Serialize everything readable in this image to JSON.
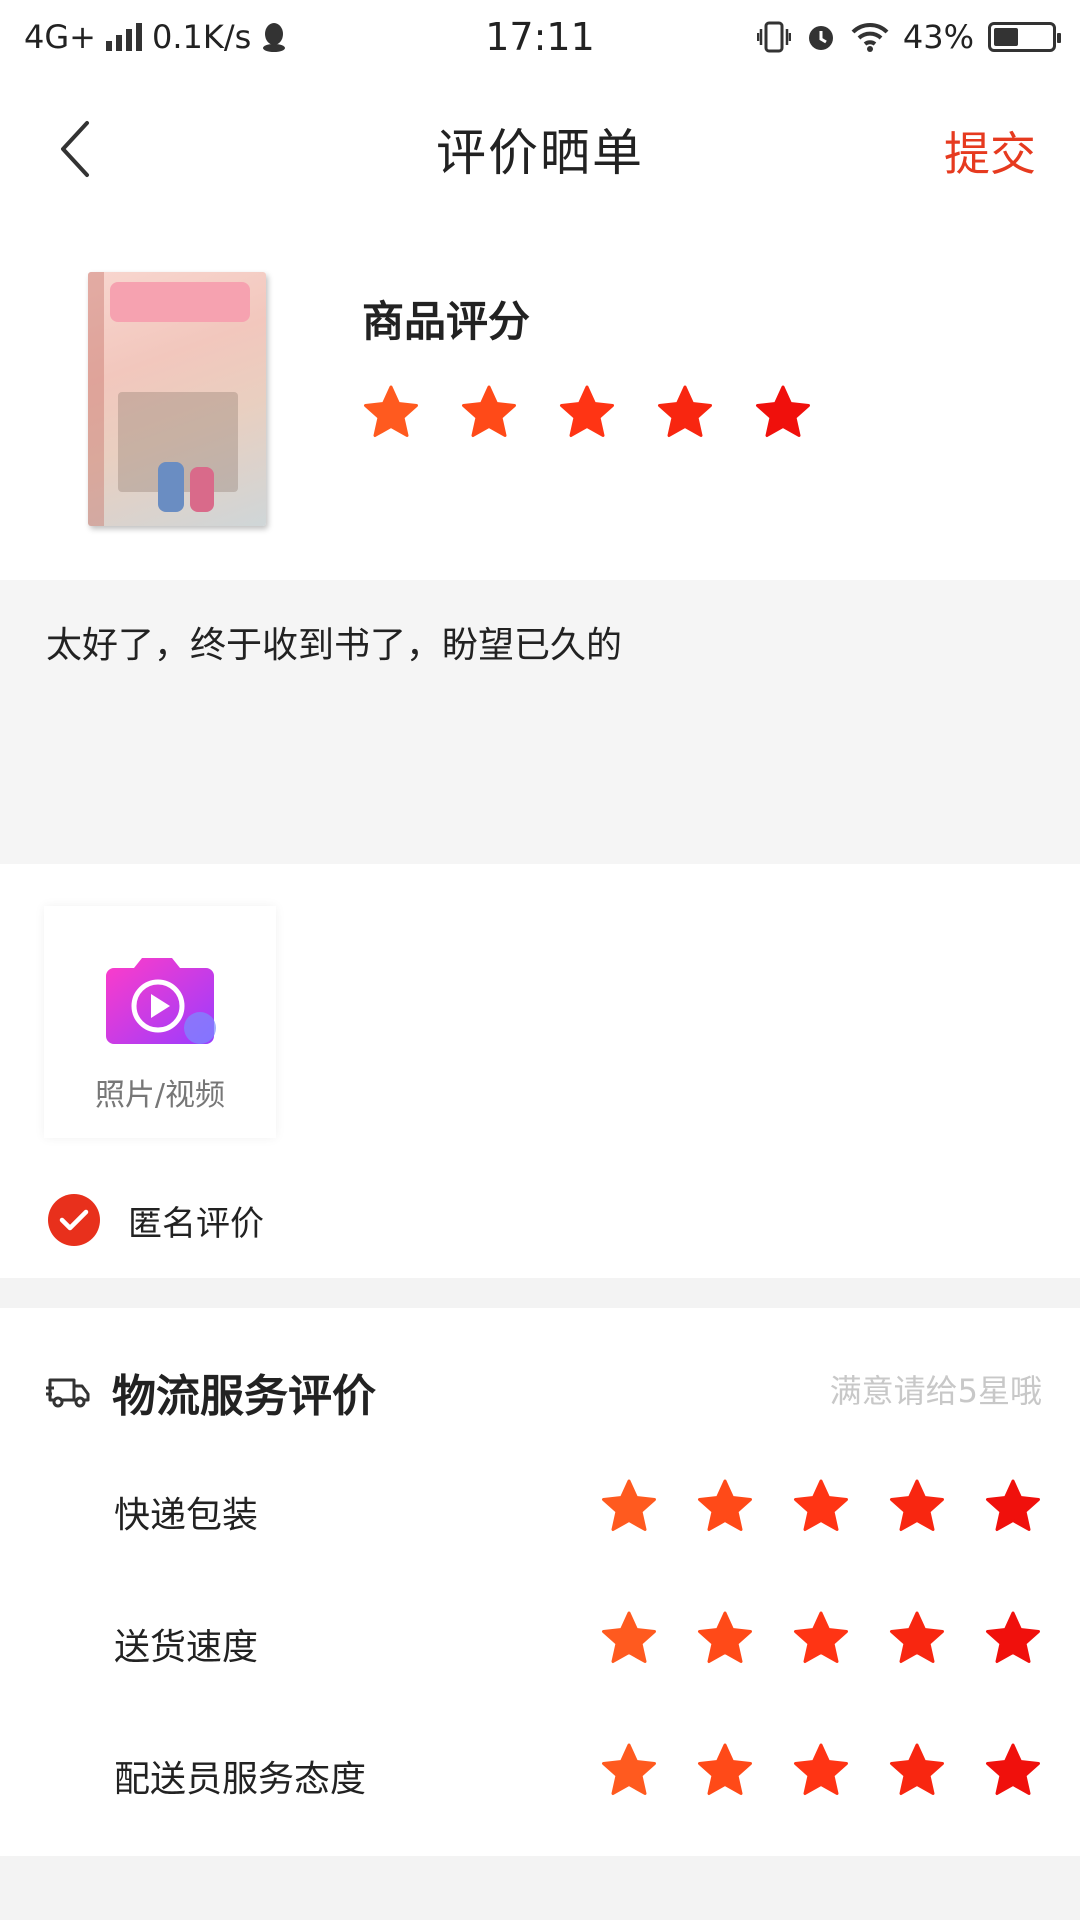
{
  "status_bar": {
    "network": "4G+",
    "speed": "0.1K/s",
    "time": "17:11",
    "battery": "43%",
    "battery_level": 0.43
  },
  "header": {
    "title": "评价晒单",
    "submit_label": "提交",
    "back_icon": "chevron-left-icon"
  },
  "product": {
    "rating_label": "商品评分",
    "rating": 5,
    "max_rating": 5
  },
  "review": {
    "text": "太好了，终于收到书了，盼望已久的"
  },
  "media": {
    "upload_label": "照片/视频",
    "upload_icon": "camera-play-icon"
  },
  "anonymous": {
    "label": "匿名评价",
    "checked": true
  },
  "logistics": {
    "title": "物流服务评价",
    "hint": "满意请给5星哦",
    "icon": "truck-icon",
    "items": [
      {
        "label": "快递包装",
        "rating": 5
      },
      {
        "label": "送货速度",
        "rating": 5
      },
      {
        "label": "配送员服务态度",
        "rating": 5
      }
    ]
  },
  "colors": {
    "accent": "#e63a1f",
    "star_gradient": [
      "#ff5a1f",
      "#ff4a18",
      "#ff3414",
      "#f82610",
      "#f0100c"
    ],
    "hint": "#c8c8c8"
  }
}
